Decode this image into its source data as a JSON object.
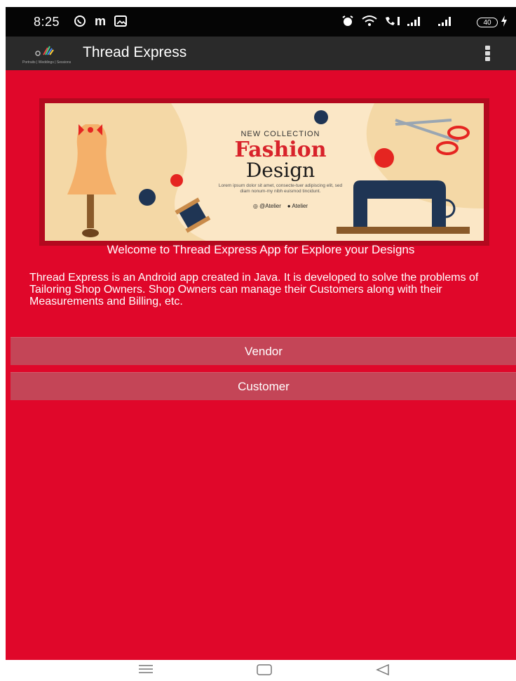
{
  "status_bar": {
    "time": "8:25",
    "notification_icons": [
      "whatsapp-icon",
      "m-icon",
      "gallery-icon"
    ],
    "system_icons": [
      "alarm-icon",
      "wifi-icon",
      "call-icon",
      "signal-icon",
      "signal-icon"
    ],
    "battery": "40"
  },
  "app_bar": {
    "title": "Thread Express",
    "logo_caption": "Portraits | Weddings | Sessions"
  },
  "banner": {
    "collection": "NEW COLLECTION",
    "heading1": "Fashion",
    "heading2": "Design",
    "body": "Lorem ipsum dolor sit amet, consecte-tuer adipiscing elit, sed diam nonum-my nibh euismod tincidunt.",
    "social1": "@Atelier",
    "social2": "Atelier"
  },
  "welcome": "Welcome to Thread Express App for Explore your Designs",
  "description": "Thread Express is an Android app created in Java. It is developed to solve the problems of Tailoring Shop Owners. Shop Owners can manage their Customers along with their Measurements and Billing, etc.",
  "buttons": {
    "vendor": "Vendor",
    "customer": "Customer"
  },
  "colors": {
    "background": "#e0072a",
    "button": "#c44557",
    "app_bar": "#2a2a2a",
    "status_bar": "#050505"
  }
}
